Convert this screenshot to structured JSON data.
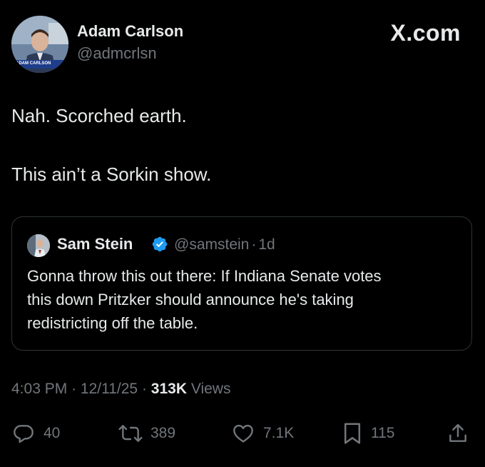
{
  "author": {
    "name": "Adam Carlson",
    "handle": "@admcrlsn",
    "avatar_caption": "ADAM CARLSON"
  },
  "brand": "X.com",
  "post": {
    "lines": [
      "Nah. Scorched earth.",
      "This ain’t a Sorkin show."
    ]
  },
  "quote": {
    "name": "Sam Stein",
    "handle": "@samstein",
    "separator": "·",
    "age": "1d",
    "verified_icon": "verified-badge-icon",
    "lines": [
      "Gonna throw this out there: If Indiana Senate votes",
      "this down Pritzker should announce he's taking",
      "redistricting off the table."
    ]
  },
  "meta": {
    "time": "4:03 PM",
    "sep1": "·",
    "date": "12/11/25",
    "sep2": "·",
    "views_count": "313K",
    "views_label": "Views"
  },
  "actions": {
    "reply_count": "40",
    "repost_count": "389",
    "like_count": "7.1K",
    "bookmark_count": "115"
  },
  "colors": {
    "background": "#000000",
    "text": "#e7e9ea",
    "muted": "#71767b",
    "border": "#2f3336",
    "verified": "#1d9bf0"
  }
}
